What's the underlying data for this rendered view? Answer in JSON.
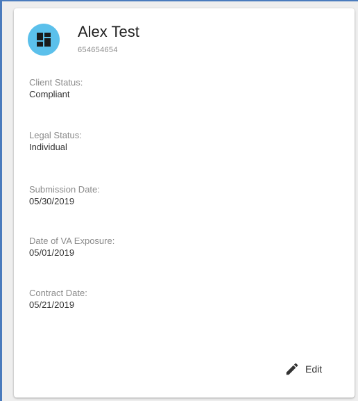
{
  "client": {
    "name": "Alex Test",
    "id_number": "654654654"
  },
  "fields": [
    {
      "label": "Client Status:",
      "value": "Compliant"
    },
    {
      "label": "Legal Status:",
      "value": "Individual"
    },
    {
      "label": "Submission Date:",
      "value": "05/30/2019"
    },
    {
      "label": "Date of VA Exposure:",
      "value": "05/01/2019"
    },
    {
      "label": "Contract Date:",
      "value": "05/21/2019"
    }
  ],
  "actions": {
    "edit_label": "Edit"
  },
  "icons": {
    "avatar": "dashboard-icon",
    "edit": "pencil-icon"
  },
  "colors": {
    "avatar_bg": "#5bc0eb",
    "frame_border": "#4a7bbd"
  }
}
